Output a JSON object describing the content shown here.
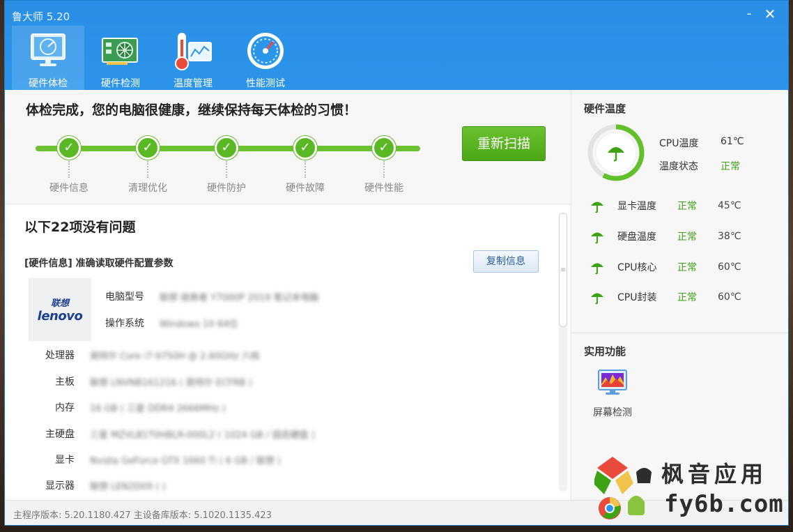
{
  "window": {
    "title": "鲁大师 5.20",
    "minimize_glyph": "-",
    "close_glyph": "✕"
  },
  "nav": {
    "items": [
      {
        "label": "硬件体检",
        "icon": "monitor-radar-icon",
        "active": true
      },
      {
        "label": "硬件检测",
        "icon": "graphics-card-icon",
        "active": false
      },
      {
        "label": "温度管理",
        "icon": "thermometer-chart-icon",
        "active": false
      },
      {
        "label": "性能测试",
        "icon": "speedometer-icon",
        "active": false
      }
    ]
  },
  "scan": {
    "title": "体检完成，您的电脑很健康，继续保持每天体检的习惯！",
    "rescan_label": "重新扫描",
    "check_glyph": "✓",
    "steps": [
      "硬件信息",
      "清理优化",
      "硬件防护",
      "硬件故障",
      "硬件性能"
    ]
  },
  "result": {
    "title": "以下22项没有问题",
    "section_title": "[硬件信息] 准确读取硬件配置参数",
    "copy_label": "复制信息",
    "logo": {
      "cn": "联想",
      "en": "lenovo"
    },
    "specs": [
      {
        "label": "电脑型号",
        "value": "联想 拯救者 Y7000P 2019 笔记本电脑"
      },
      {
        "label": "操作系统",
        "value": "Windows 10 64位"
      },
      {
        "label": "处理器",
        "value": "英特尔 Core i7-9750H @ 2.60GHz 六核"
      },
      {
        "label": "主板",
        "value": "联想 LNVNB161216 ( 英特尔 ECFRB )"
      },
      {
        "label": "内存",
        "value": "16 GB ( 三星 DDR4 2666MHz )"
      },
      {
        "label": "主硬盘",
        "value": "三星 MZVLB1T0HBLR-000L2 ( 1024 GB / 固态硬盘 )"
      },
      {
        "label": "显卡",
        "value": "Nvidia GeForce GTX 1660 Ti ( 6 GB / 联想 )"
      },
      {
        "label": "显示器",
        "value": "联想 LEN2D09 ( )"
      }
    ],
    "scroll_grip": "≡"
  },
  "temps": {
    "header": "硬件温度",
    "cpu_label": "CPU温度",
    "cpu_value": "61℃",
    "state_label": "温度状态",
    "state_value": "正常",
    "gauge_fraction": 0.58,
    "rows": [
      {
        "name": "显卡温度",
        "status": "正常",
        "value": "45℃"
      },
      {
        "name": "硬盘温度",
        "status": "正常",
        "value": "38℃"
      },
      {
        "name": "CPU核心",
        "status": "正常",
        "value": "60℃"
      },
      {
        "name": "CPU封装",
        "status": "正常",
        "value": "60℃"
      }
    ]
  },
  "tools": {
    "header": "实用功能",
    "items": [
      {
        "label": "屏幕检测",
        "icon": "screen-test-icon"
      }
    ]
  },
  "footer": {
    "text": "主程序版本: 5.20.1180.427   主设备库版本: 5.1020.1135.423"
  },
  "watermark": {
    "line1": "枫音应用",
    "line2": "fy6b.com"
  },
  "colors": {
    "titlebar": "#2b95ea",
    "accent_green": "#5ab824",
    "ok_text": "#3ea313",
    "gauge_ring": "#62c12a"
  }
}
